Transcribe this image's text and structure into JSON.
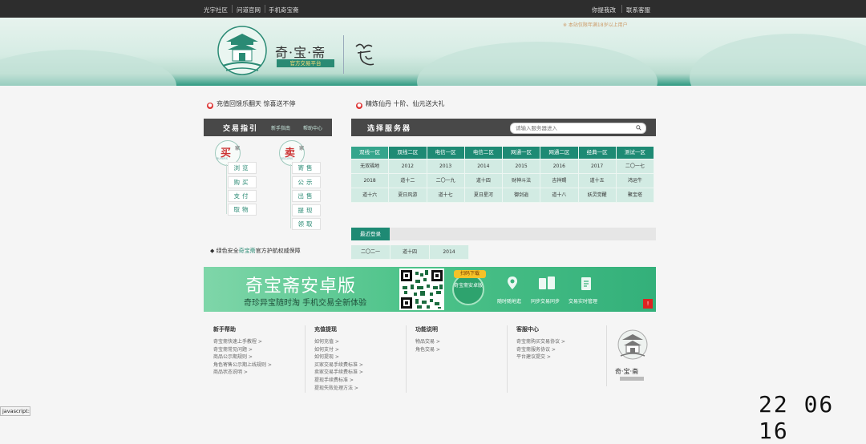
{
  "topbar": {
    "left_links": [
      "光宇社区",
      "问道官网",
      "手机奇宝斋"
    ],
    "right_links": [
      "你提我改",
      "联系客服"
    ]
  },
  "banner": {
    "note": "※ 本站仅限年满18岁以上用户",
    "logo_title": "奇·宝·斋",
    "logo_tagline": "官方交易平台",
    "logo_sign": "问道"
  },
  "announcements": [
    "充值回馈乐翻天 惊喜送不停",
    "精炼仙丹 十阶、仙元送大礼"
  ],
  "guide": {
    "title": "交易指引",
    "links": [
      "新手指南",
      "帮助中心"
    ],
    "buyer": {
      "badge": "买",
      "badge_suffix": "家",
      "badge_ring": "BUYERS",
      "items": [
        "浏览",
        "购买",
        "支付",
        "取物"
      ]
    },
    "seller": {
      "badge": "卖",
      "badge_suffix": "家",
      "badge_ring": "SELLERS",
      "items": [
        "寄售",
        "公示",
        "出售",
        "提现",
        "领取"
      ]
    },
    "safety_pre": "绿色安全",
    "safety_brand": "奇宝斋",
    "safety_post": "官方护航权威保障"
  },
  "server": {
    "title": "选择服务器",
    "search_placeholder": "请输入服务器进入",
    "tabs": [
      "双线一区",
      "双线二区",
      "电信一区",
      "电信二区",
      "网通一区",
      "网通二区",
      "经典一区",
      "测试一区"
    ],
    "active_tab": 0,
    "rows": [
      [
        "无双福地",
        "2012",
        "2013",
        "2014",
        "2015",
        "2016",
        "2017",
        "二〇一七"
      ],
      [
        "2018",
        "道十二",
        "二〇一九",
        "道十四",
        "财神斗法",
        "吉祥赐",
        "道十五",
        "鸿运牛"
      ],
      [
        "道十六",
        "夏日风游",
        "道十七",
        "夏日星河",
        "御剑逍",
        "道十八",
        "妖灵觉醒",
        "聚宝塔"
      ]
    ],
    "recent_label": "最近登录",
    "recent": [
      "二〇二一",
      "道十四",
      "2014"
    ]
  },
  "promo": {
    "title": "奇宝斋安卓版",
    "subtitle": "奇珍异宝随时淘 手机交易全新体验",
    "scan_label": "扫码下载",
    "scan_sub": "奇宝斋安卓版",
    "features": [
      "随时随地逛",
      "同步交易同步",
      "交易实时管理"
    ],
    "close_glyph": "!"
  },
  "footer": {
    "columns": [
      {
        "title": "新手帮助",
        "items": [
          "奇宝斋快速上手教程 >",
          "奇宝斋常见问题 >",
          "商品公示期规则 >",
          "角色寄售公示期上线规则 >",
          "商品状态说明 >"
        ]
      },
      {
        "title": "充值提现",
        "items": [
          "如何充值 >",
          "如何支付 >",
          "如何提现 >",
          "买家交易手续费标准 >",
          "卖家交易手续费标准 >",
          "提现手续费标准 >",
          "提现失败处理方法 >"
        ]
      },
      {
        "title": "功能说明",
        "items": [
          "物品交易 >",
          "角色交易 >"
        ]
      },
      {
        "title": "客服中心",
        "items": [
          "奇宝斋购买交易协议 >",
          "奇宝斋服务协议 >",
          "平台建议提交 >"
        ]
      }
    ],
    "logo_text": "奇·宝·斋"
  },
  "status_bar": "javascript:",
  "clock": "22 06 16",
  "colors": {
    "accent": "#1e8a74",
    "topbar": "#2d2d2d",
    "cell": "#d2ebe3",
    "promo": "#4ec38a"
  }
}
